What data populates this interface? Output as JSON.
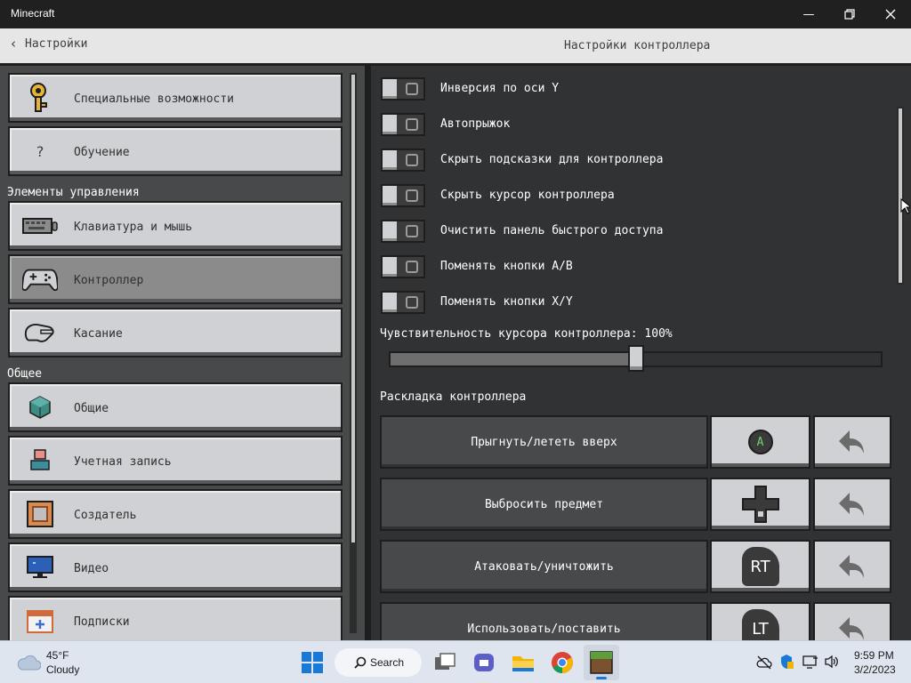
{
  "window": {
    "title": "Minecraft"
  },
  "header": {
    "back_label": "Настройки",
    "page_title": "Настройки контроллера"
  },
  "sidebar": {
    "items_top": [
      {
        "label": "Специальные возможности",
        "icon": "key-icon"
      },
      {
        "label": "Обучение",
        "icon": "question-icon"
      }
    ],
    "section_controls": "Элементы управления",
    "items_controls": [
      {
        "label": "Клавиатура и мышь",
        "icon": "keyboard-icon"
      },
      {
        "label": "Контроллер",
        "icon": "gamepad-icon",
        "selected": true
      },
      {
        "label": "Касание",
        "icon": "touch-icon"
      }
    ],
    "section_general": "Общее",
    "items_general": [
      {
        "label": "Общие",
        "icon": "cube-icon"
      },
      {
        "label": "Учетная запись",
        "icon": "account-icon"
      },
      {
        "label": "Создатель",
        "icon": "creator-icon"
      },
      {
        "label": "Видео",
        "icon": "monitor-icon"
      },
      {
        "label": "Подписки",
        "icon": "subscription-icon"
      }
    ]
  },
  "toggles": [
    {
      "label": "Инверсия по оси Y",
      "on": false
    },
    {
      "label": "Автопрыжок",
      "on": false
    },
    {
      "label": "Скрыть подсказки для контроллера",
      "on": false
    },
    {
      "label": "Скрыть курсор контроллера",
      "on": false
    },
    {
      "label": "Очистить панель быстрого доступа",
      "on": false
    },
    {
      "label": "Поменять кнопки A/B",
      "on": false
    },
    {
      "label": "Поменять кнопки X/Y",
      "on": false
    }
  ],
  "sensitivity": {
    "label": "Чувствительность курсора контроллера: 100%",
    "fraction": 0.5
  },
  "layout": {
    "title": "Раскладка контроллера",
    "bindings": [
      {
        "action": "Прыгнуть/лететь вверх",
        "key_icon": "a-button-icon",
        "key_label": "A"
      },
      {
        "action": "Выбросить предмет",
        "key_icon": "dpad-icon",
        "key_label": ""
      },
      {
        "action": "Атаковать/уничтожить",
        "key_icon": "rt-trigger-icon",
        "key_label": "RT"
      },
      {
        "action": "Использовать/поставить",
        "key_icon": "lt-trigger-icon",
        "key_label": "LT"
      }
    ]
  },
  "taskbar": {
    "temp": "45°F",
    "weather": "Cloudy",
    "search": "Search",
    "time": "9:59 PM",
    "date": "3/2/2023"
  },
  "colors": {
    "panel_dark": "#313233",
    "panel_mid": "#48494a",
    "button_light": "#d0d1d4",
    "selected": "#8b8b8c"
  }
}
